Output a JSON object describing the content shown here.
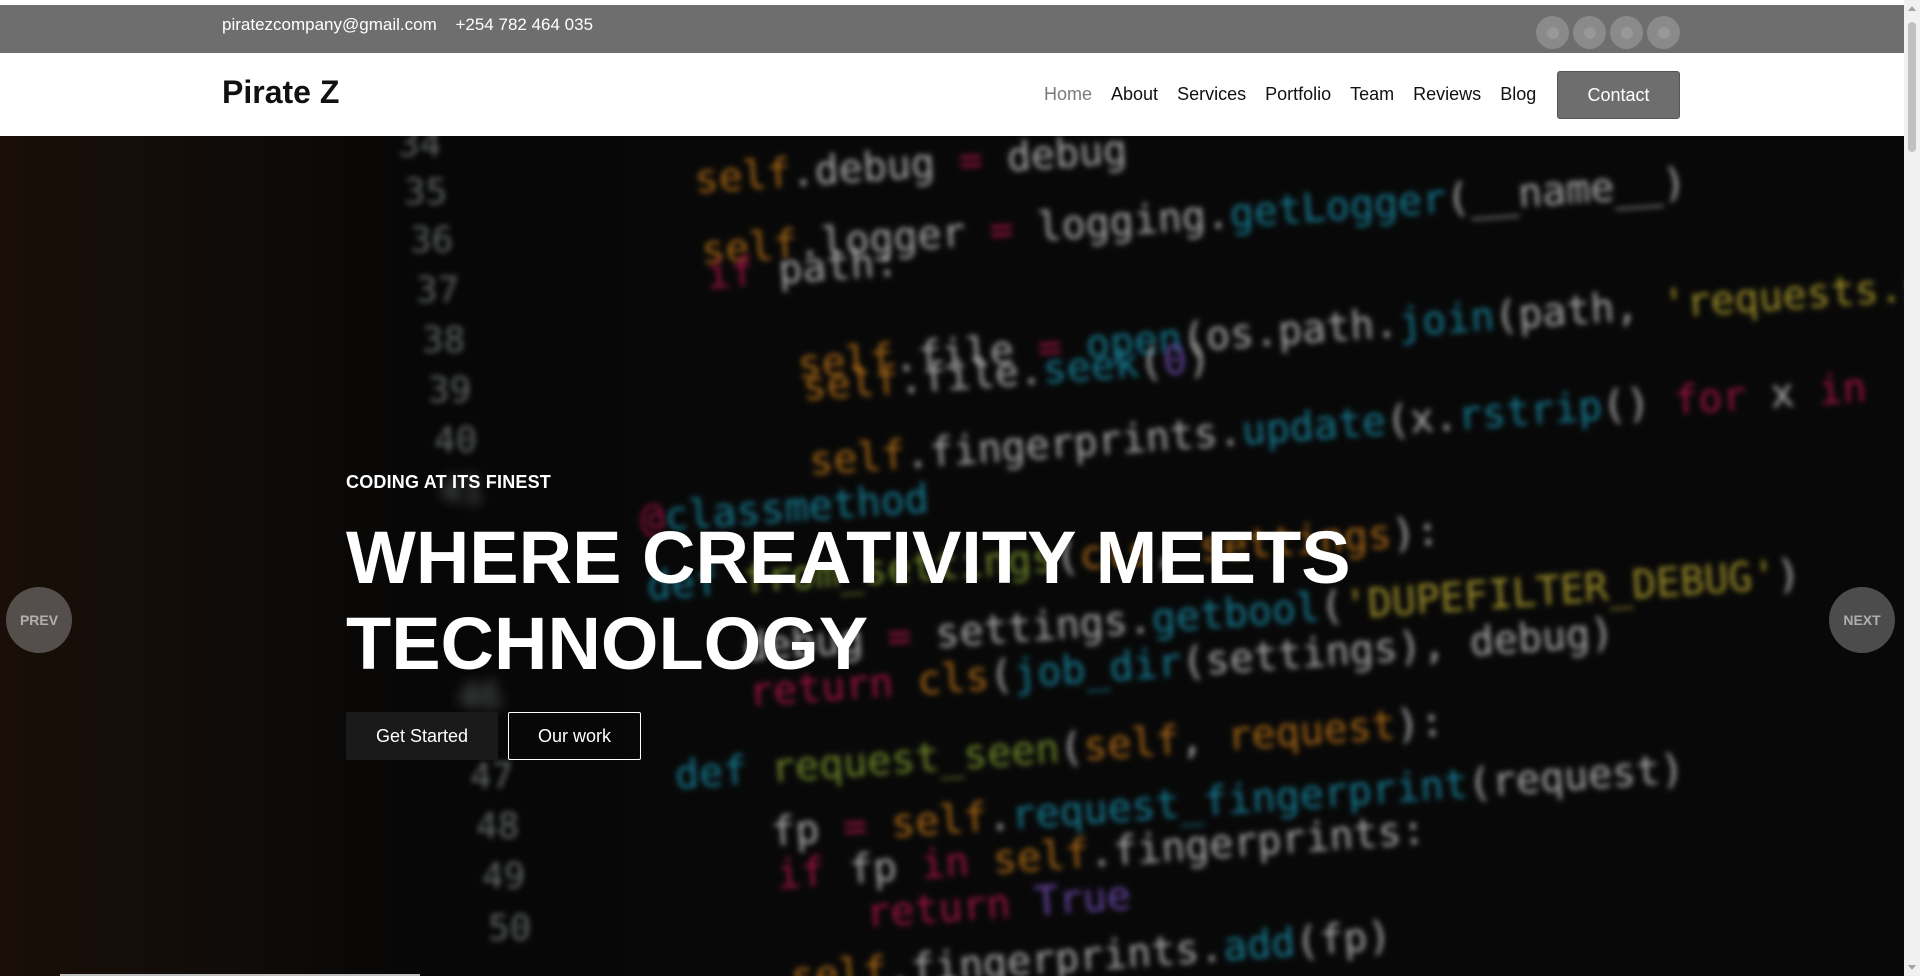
{
  "topbar": {
    "email": "piratezcompany@gmail.com",
    "phone": "+254 782 464 035",
    "socials": [
      "twitter-icon",
      "facebook-icon",
      "instagram-icon",
      "linkedin-icon"
    ]
  },
  "header": {
    "logo": "Pirate Z",
    "nav": [
      {
        "label": "Home",
        "active": true
      },
      {
        "label": "About",
        "active": false
      },
      {
        "label": "Services",
        "active": false
      },
      {
        "label": "Portfolio",
        "active": false
      },
      {
        "label": "Team",
        "active": false
      },
      {
        "label": "Reviews",
        "active": false
      },
      {
        "label": "Blog",
        "active": false
      }
    ],
    "contact_label": "Contact"
  },
  "hero": {
    "eyebrow": "CODING AT ITS FINEST",
    "headline": "WHERE CREATIVITY MEETS TECHNOLOGY",
    "primary_button": "Get Started",
    "secondary_button": "Our work",
    "prev_label": "PREV",
    "next_label": "NEXT"
  },
  "colors": {
    "topbar_bg": "#6e6e6e",
    "button_gray": "#6e6e6e",
    "nav_active": "#7a7a7a",
    "hero_bg": "#0c0c0c"
  }
}
